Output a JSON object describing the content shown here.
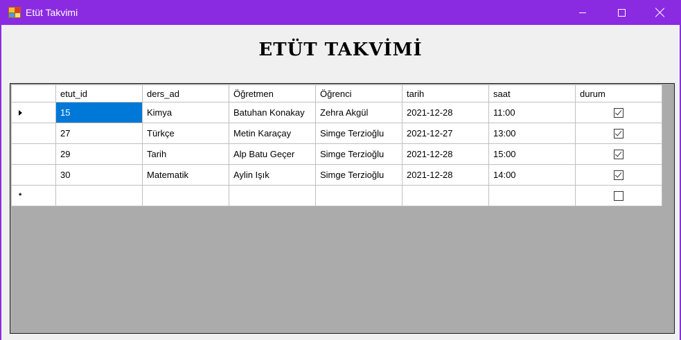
{
  "window": {
    "title": "Etüt Takvimi",
    "accent_color": "#8a2be2",
    "icon": "app-form-icon"
  },
  "heading": "ETÜT TAKVİMİ",
  "grid": {
    "columns": [
      "etut_id",
      "ders_ad",
      "Öğretmen",
      "Öğrenci",
      "tarih",
      "saat",
      "durum"
    ],
    "rows": [
      {
        "etut_id": "15",
        "ders_ad": "Kimya",
        "ogretmen": "Batuhan Konakay",
        "ogrenci": "Zehra Akgül",
        "tarih": "2021-12-28",
        "saat": "11:00",
        "durum": true
      },
      {
        "etut_id": "27",
        "ders_ad": "Türkçe",
        "ogretmen": "Metin Karaçay",
        "ogrenci": "Simge Terzioğlu",
        "tarih": "2021-12-27",
        "saat": "13:00",
        "durum": true
      },
      {
        "etut_id": "29",
        "ders_ad": "Tarih",
        "ogretmen": "Alp Batu Geçer",
        "ogrenci": "Simge Terzioğlu",
        "tarih": "2021-12-28",
        "saat": "15:00",
        "durum": true
      },
      {
        "etut_id": "30",
        "ders_ad": "Matematik",
        "ogretmen": "Aylin Işık",
        "ogrenci": "Simge Terzioğlu",
        "tarih": "2021-12-28",
        "saat": "14:00",
        "durum": true
      }
    ],
    "new_row_marker": "*",
    "selected_cell_color": "#0078d7"
  }
}
